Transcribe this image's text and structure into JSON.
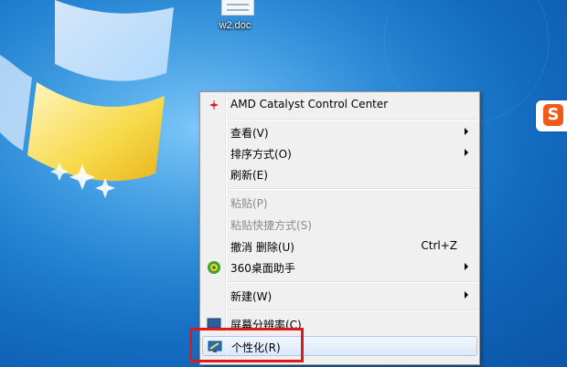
{
  "desktop": {
    "file": {
      "name": "w2.doc",
      "icon": "document-icon"
    },
    "tray_icon": {
      "name": "sogou-icon",
      "glyph": "S"
    }
  },
  "context_menu": {
    "items": [
      {
        "label": "AMD Catalyst Control Center",
        "icon": "amd-catalyst-icon",
        "disabled": false
      },
      {
        "label": "查看(V)",
        "submenu": true
      },
      {
        "label": "排序方式(O)",
        "submenu": true
      },
      {
        "label": "刷新(E)"
      },
      {
        "label": "粘贴(P)",
        "disabled": true
      },
      {
        "label": "粘贴快捷方式(S)",
        "disabled": true
      },
      {
        "label": "撤消 删除(U)",
        "shortcut": "Ctrl+Z"
      },
      {
        "label": "360桌面助手",
        "icon": "360-assistant-icon",
        "submenu": true
      },
      {
        "label": "新建(W)",
        "submenu": true
      },
      {
        "label": "屏幕分辨率(C)",
        "icon": "screen-resolution-icon"
      },
      {
        "label": "个性化(R)",
        "icon": "personalize-icon",
        "highlighted": true
      }
    ]
  },
  "colors": {
    "highlight_border": "#e01818",
    "desktop_blue": "#1d7fd0"
  }
}
